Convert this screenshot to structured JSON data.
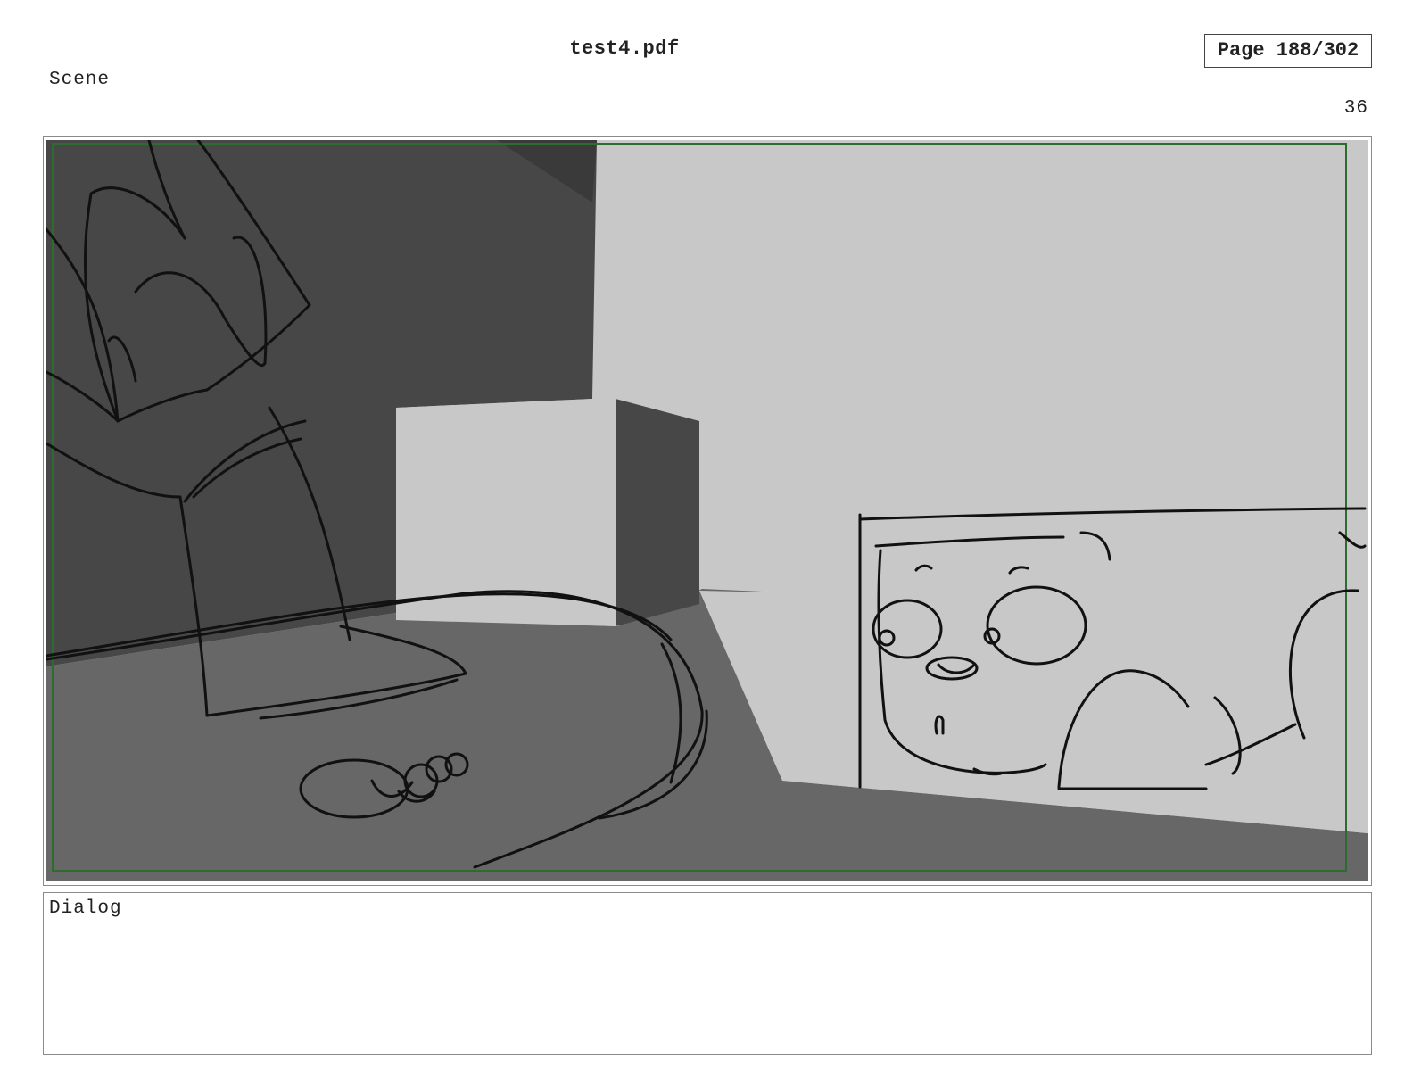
{
  "header": {
    "document_title": "test4.pdf",
    "page_indicator": "Page 188/302"
  },
  "scene": {
    "label": "Scene",
    "number": "36"
  },
  "dialog": {
    "label": "Dialog"
  },
  "colors": {
    "safe_frame": "#2e6b2e",
    "dark_wall": "#474747",
    "light_wall": "#c8c8c8",
    "floor": "#676767",
    "ink": "#111111"
  }
}
